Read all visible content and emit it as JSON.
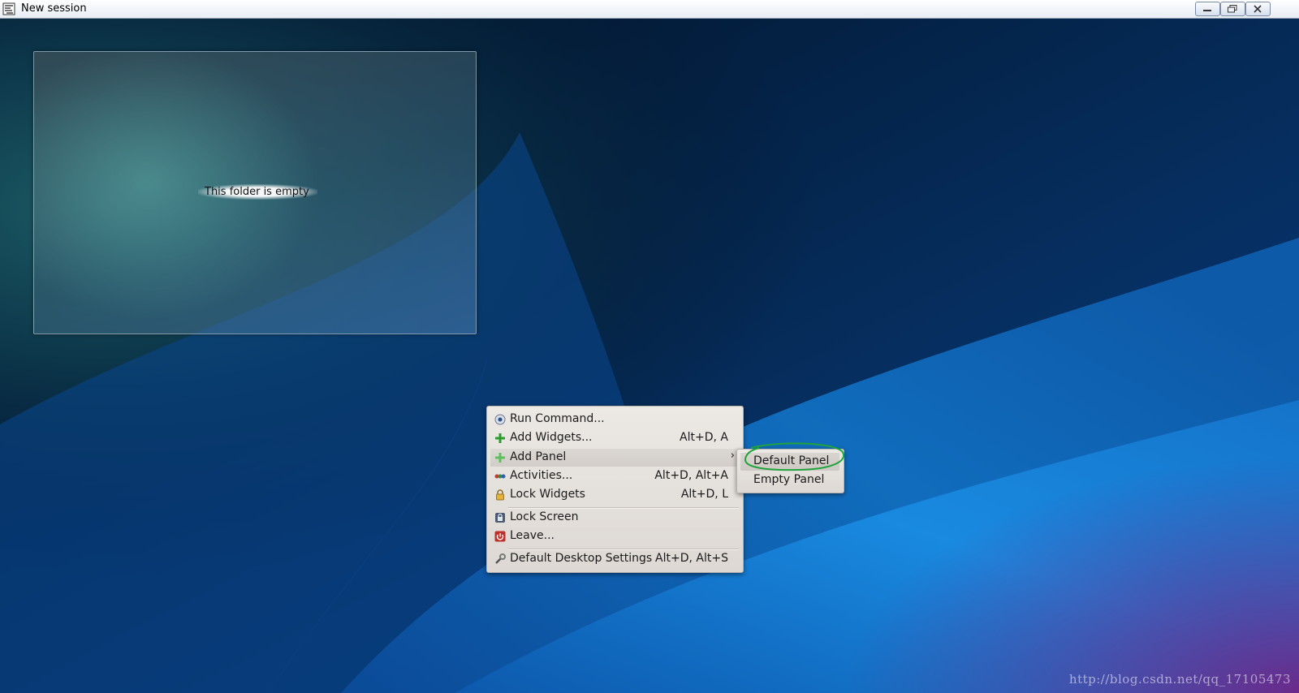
{
  "window": {
    "title": "New session",
    "buttons": [
      "minimize",
      "restore",
      "close"
    ]
  },
  "folder_view": {
    "empty_message": "This folder is empty"
  },
  "context_menu": {
    "items": [
      {
        "label": "Run Command...",
        "shortcut": "",
        "icon": "run-command-icon"
      },
      {
        "label": "Add Widgets...",
        "shortcut": "Alt+D, A",
        "icon": "add-icon"
      },
      {
        "label": "Add Panel",
        "shortcut": "",
        "icon": "add-icon",
        "has_submenu": true,
        "highlighted": true
      },
      {
        "label": "Activities...",
        "shortcut": "Alt+D, Alt+A",
        "icon": "activities-icon"
      },
      {
        "label": "Lock Widgets",
        "shortcut": "Alt+D, L",
        "icon": "lock-icon"
      },
      {
        "label": "Lock Screen",
        "shortcut": "",
        "icon": "lock-screen-icon"
      },
      {
        "label": "Leave...",
        "shortcut": "",
        "icon": "power-icon"
      },
      {
        "label": "Default Desktop Settings",
        "shortcut": "Alt+D, Alt+S",
        "icon": "wrench-icon"
      }
    ],
    "submenu_arrow": "›"
  },
  "submenu": {
    "items": [
      {
        "label": "Default Panel",
        "highlighted": true
      },
      {
        "label": "Empty Panel"
      }
    ]
  },
  "watermark": "http://blog.csdn.net/qq_17105473",
  "colors": {
    "annotation": "#1fa33a",
    "menu_bg": "#e6e2de"
  }
}
